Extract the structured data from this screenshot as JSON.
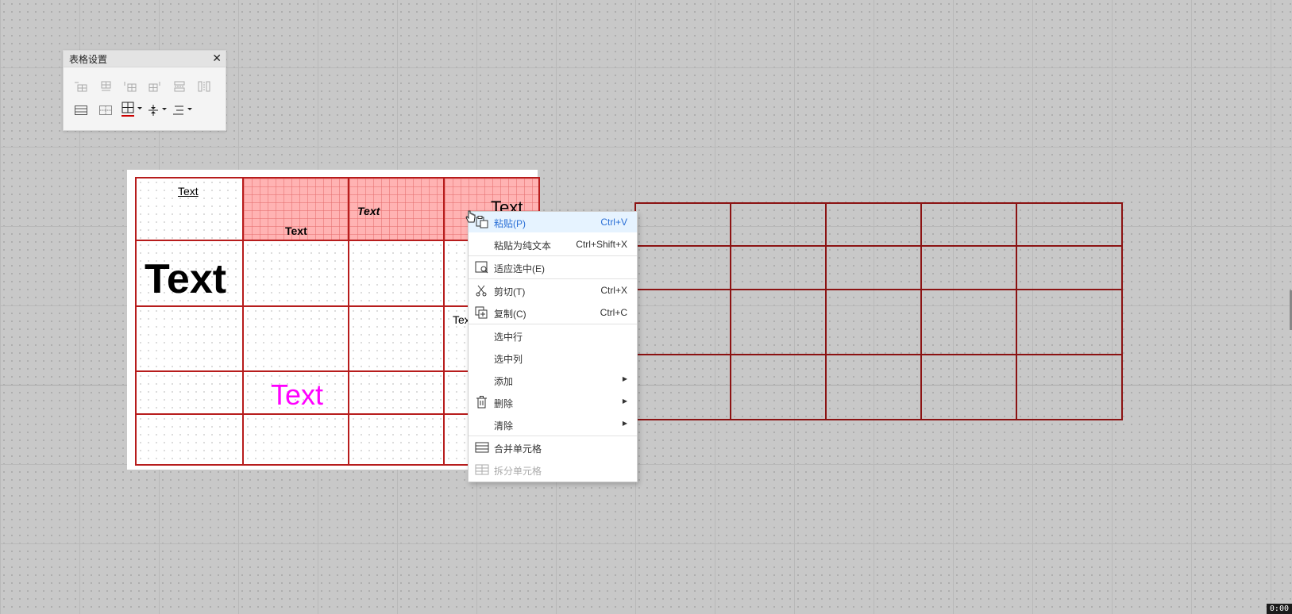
{
  "panel": {
    "title": "表格设置",
    "close": "✕"
  },
  "left_table": {
    "cells": {
      "r1c1": "Text",
      "r1c2": "Text",
      "r1c3": "Text",
      "r1c4": "Text",
      "r2c1": "Text",
      "r3c4": "Tex",
      "r4c2": "Text"
    }
  },
  "context_menu": {
    "items": [
      {
        "label": "粘贴(P)",
        "shortcut": "Ctrl+V",
        "icon": "paste-icon"
      },
      {
        "label": "粘贴为纯文本",
        "shortcut": "Ctrl+Shift+X"
      },
      {
        "label": "适应选中(E)",
        "icon": "fit-selection-icon"
      },
      {
        "label": "剪切(T)",
        "shortcut": "Ctrl+X",
        "icon": "scissors-icon"
      },
      {
        "label": "复制(C)",
        "shortcut": "Ctrl+C",
        "icon": "copy-icon"
      },
      {
        "label": "选中行"
      },
      {
        "label": "选中列"
      },
      {
        "label": "添加",
        "arrow": "▶"
      },
      {
        "label": "删除",
        "arrow": "▶",
        "icon": "trash-icon"
      },
      {
        "label": "清除",
        "arrow": "▶"
      },
      {
        "label": "合并单元格",
        "icon": "merge-cells-icon"
      },
      {
        "label": "拆分单元格",
        "icon": "split-cells-icon"
      }
    ]
  },
  "timer": "0:00",
  "colors": {
    "table_border": "#b71c1c",
    "selection": "#ffb3b3",
    "menu_highlight": "#e6f3ff",
    "magenta_text": "#ff00ff"
  }
}
